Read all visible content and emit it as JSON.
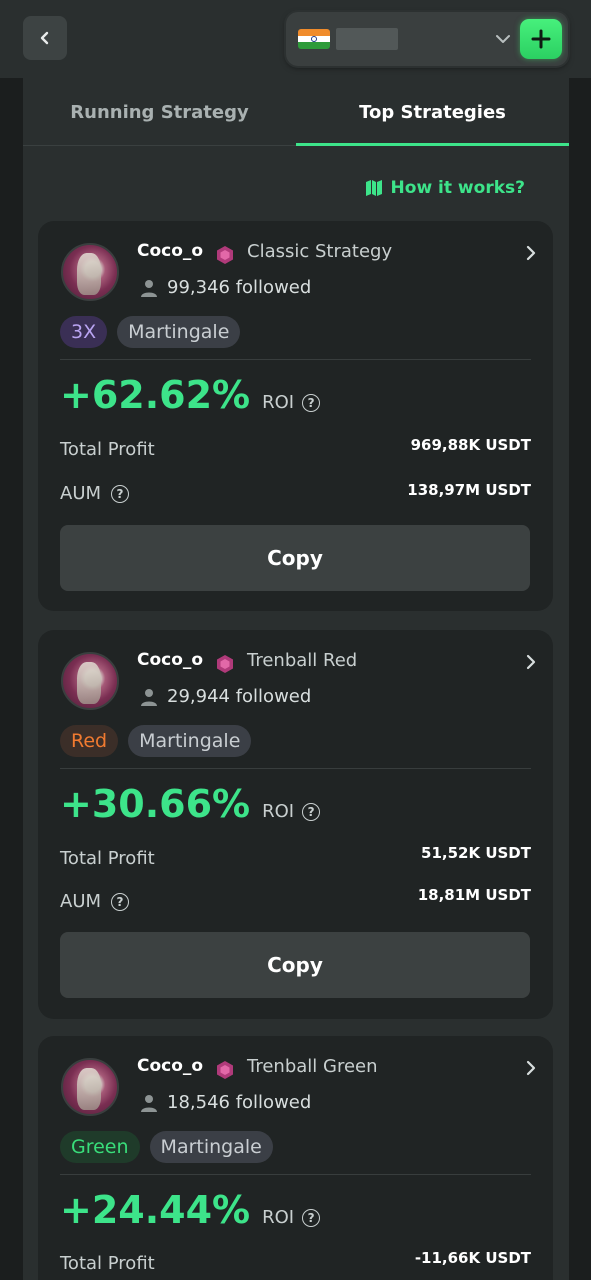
{
  "header": {
    "back_icon": "chevron-left-icon",
    "currency_flag": "india-flag-icon",
    "dropdown_icon": "chevron-down-icon",
    "add_icon": "plus-icon"
  },
  "tabs": [
    {
      "label": "Running Strategy",
      "active": false
    },
    {
      "label": "Top Strategies",
      "active": true
    }
  ],
  "how_it_works": {
    "label": "How it works?",
    "icon": "map-icon"
  },
  "cards": [
    {
      "name": "Coco_o",
      "strategy": "Classic Strategy",
      "followers": "99,346 followed",
      "tags": [
        {
          "label": "3X",
          "style": "purple"
        },
        {
          "label": "Martingale",
          "style": "gray"
        }
      ],
      "roi": "+62.62%",
      "roi_label": "ROI",
      "total_profit_label": "Total Profit",
      "total_profit": "969,88K USDT",
      "aum_label": "AUM",
      "aum": "138,97M USDT",
      "copy_label": "Copy"
    },
    {
      "name": "Coco_o",
      "strategy": "Trenball Red",
      "followers": "29,944 followed",
      "tags": [
        {
          "label": "Red",
          "style": "red"
        },
        {
          "label": "Martingale",
          "style": "gray"
        }
      ],
      "roi": "+30.66%",
      "roi_label": "ROI",
      "total_profit_label": "Total Profit",
      "total_profit": "51,52K USDT",
      "aum_label": "AUM",
      "aum": "18,81M USDT",
      "copy_label": "Copy"
    },
    {
      "name": "Coco_o",
      "strategy": "Trenball Green",
      "followers": "18,546 followed",
      "tags": [
        {
          "label": "Green",
          "style": "green"
        },
        {
          "label": "Martingale",
          "style": "gray"
        }
      ],
      "roi": "+24.44%",
      "roi_label": "ROI",
      "total_profit_label": "Total Profit",
      "total_profit": "-11,66K USDT"
    }
  ],
  "colors": {
    "accent": "#3de48a",
    "background": "#1b1e1e",
    "panel": "#2a2f2f",
    "card": "#202424"
  }
}
